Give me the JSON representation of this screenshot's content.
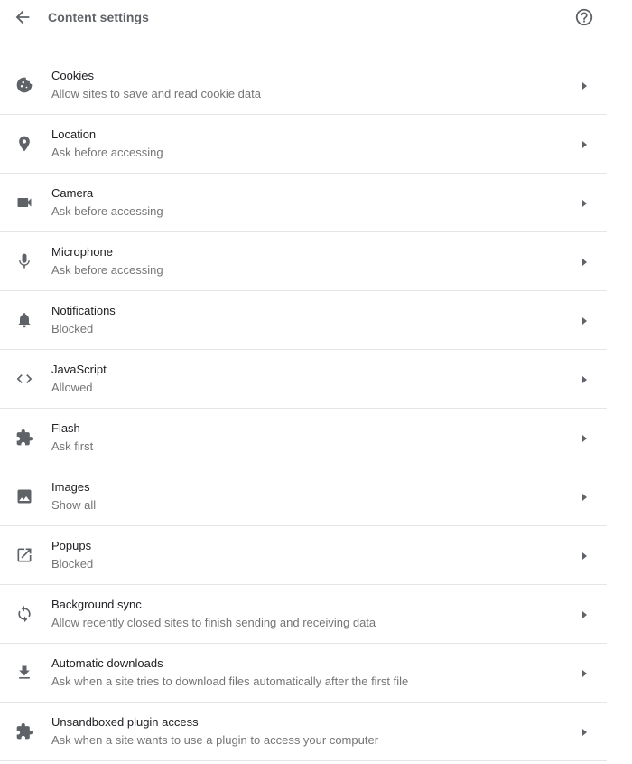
{
  "header": {
    "title": "Content settings",
    "back_icon": "arrow-back-icon",
    "help_icon": "help-circle-icon"
  },
  "colors": {
    "icon": "#5f6368",
    "divider": "#e5e5e5",
    "label": "#202124",
    "sublabel": "#757575"
  },
  "settings": [
    {
      "label": "Cookies",
      "sub": "Allow sites to save and read cookie data",
      "icon": "cookie-icon"
    },
    {
      "label": "Location",
      "sub": "Ask before accessing",
      "icon": "location-pin-icon"
    },
    {
      "label": "Camera",
      "sub": "Ask before accessing",
      "icon": "camera-icon"
    },
    {
      "label": "Microphone",
      "sub": "Ask before accessing",
      "icon": "microphone-icon"
    },
    {
      "label": "Notifications",
      "sub": "Blocked",
      "icon": "bell-icon"
    },
    {
      "label": "JavaScript",
      "sub": "Allowed",
      "icon": "code-icon"
    },
    {
      "label": "Flash",
      "sub": "Ask first",
      "icon": "puzzle-piece-icon"
    },
    {
      "label": "Images",
      "sub": "Show all",
      "icon": "image-icon"
    },
    {
      "label": "Popups",
      "sub": "Blocked",
      "icon": "open-in-new-icon"
    },
    {
      "label": "Background sync",
      "sub": "Allow recently closed sites to finish sending and receiving data",
      "icon": "sync-icon"
    },
    {
      "label": "Automatic downloads",
      "sub": "Ask when a site tries to download files automatically after the first file",
      "icon": "download-icon"
    },
    {
      "label": "Unsandboxed plugin access",
      "sub": "Ask when a site wants to use a plugin to access your computer",
      "icon": "puzzle-piece-icon"
    }
  ]
}
